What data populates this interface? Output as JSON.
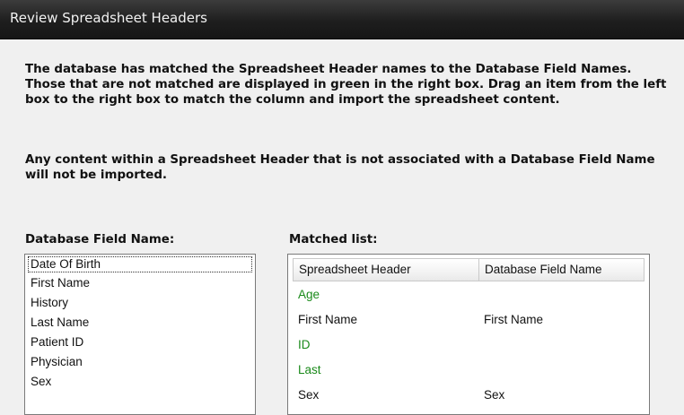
{
  "window": {
    "title": "Review Spreadsheet Headers"
  },
  "instructions": {
    "paragraph1": "The database has matched the Spreadsheet Header names to the Database Field Names.  Those that are not matched are displayed in green in the right box.  Drag an item from the left box to the right box to match the column and import the spreadsheet content.",
    "paragraph2": "Any content within a Spreadsheet Header that is not associated with a Database Field Name will not be imported."
  },
  "field_list": {
    "label": "Database Field Name:",
    "items": [
      {
        "label": "Date Of Birth"
      },
      {
        "label": "First Name"
      },
      {
        "label": "History"
      },
      {
        "label": "Last Name"
      },
      {
        "label": "Patient ID"
      },
      {
        "label": "Physician"
      },
      {
        "label": "Sex"
      }
    ]
  },
  "matched_list": {
    "label": "Matched list:",
    "columns": [
      "Spreadsheet Header",
      "Database Field Name"
    ],
    "rows": [
      {
        "header": "Age",
        "field": "",
        "matched": false
      },
      {
        "header": "First Name",
        "field": "First Name",
        "matched": true
      },
      {
        "header": "ID",
        "field": "",
        "matched": false
      },
      {
        "header": "Last",
        "field": "",
        "matched": false
      },
      {
        "header": "Sex",
        "field": "Sex",
        "matched": true
      }
    ]
  },
  "colors": {
    "titlebar_bg": "#1e1e1e",
    "title_text": "#f2f2f2",
    "dialog_bg": "#f0f0f0",
    "unmatched_text": "#1a8a1a",
    "matched_text": "#111111"
  }
}
